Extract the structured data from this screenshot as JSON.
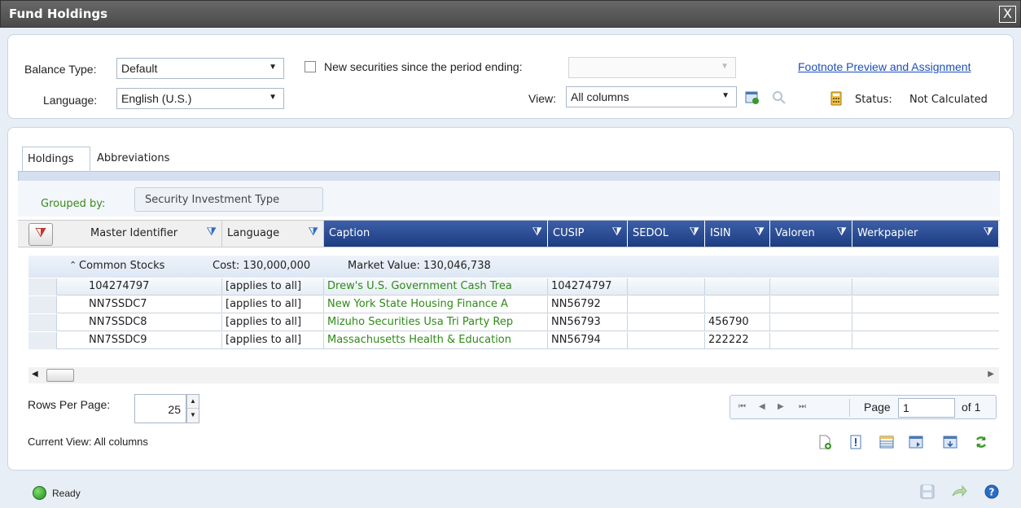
{
  "window": {
    "title": "Fund Holdings",
    "close_glyph": "X"
  },
  "filters": {
    "balance_type_label": "Balance Type:",
    "balance_type_value": "Default",
    "language_label": "Language:",
    "language_value": "English (U.S.)",
    "new_securities_label": "New securities since the period ending:",
    "new_securities_value": "",
    "view_label": "View:",
    "view_value": "All columns",
    "footnote_link": "Footnote Preview and Assignment",
    "status_label": "Status:",
    "status_value": "Not Calculated"
  },
  "tabs": [
    {
      "label": "Holdings",
      "active": true
    },
    {
      "label": "Abbreviations",
      "active": false
    }
  ],
  "grid": {
    "grouped_by_label": "Grouped by:",
    "group_chip": "Security Investment Type",
    "columns": [
      "Master Identifier",
      "Language",
      "Caption",
      "CUSIP",
      "SEDOL",
      "ISIN",
      "Valoren",
      "Werkpapier"
    ],
    "group": {
      "name": "Common Stocks",
      "cost": "Cost: 130,000,000",
      "market_value": "Market Value: 130,046,738"
    },
    "rows": [
      [
        "104274797",
        "[applies to all]",
        "Drew's U.S. Government Cash Trea",
        "104274797",
        "",
        "",
        "",
        ""
      ],
      [
        "NN7SSDC7",
        "[applies to all]",
        "New York State Housing Finance A",
        "NN56792",
        "",
        "",
        "",
        ""
      ],
      [
        "NN7SSDC8",
        "[applies to all]",
        "Mizuho Securities Usa Tri Party Rep",
        "NN56793",
        "",
        "456790",
        "",
        ""
      ],
      [
        "NN7SSDC9",
        "[applies to all]",
        "Massachusetts Health & Education",
        "NN56794",
        "",
        "222222",
        "",
        ""
      ]
    ]
  },
  "footer": {
    "rows_per_page_label": "Rows Per Page:",
    "rows_per_page_value": "25",
    "current_view": "Current View: All columns",
    "page_label": "Page",
    "page_value": "1",
    "page_of": "of 1"
  },
  "status_bar": {
    "text": "Ready"
  },
  "colors": {
    "accent": "#1c3d82",
    "link": "#1d4fb8",
    "caption_text": "#2e8a18"
  }
}
